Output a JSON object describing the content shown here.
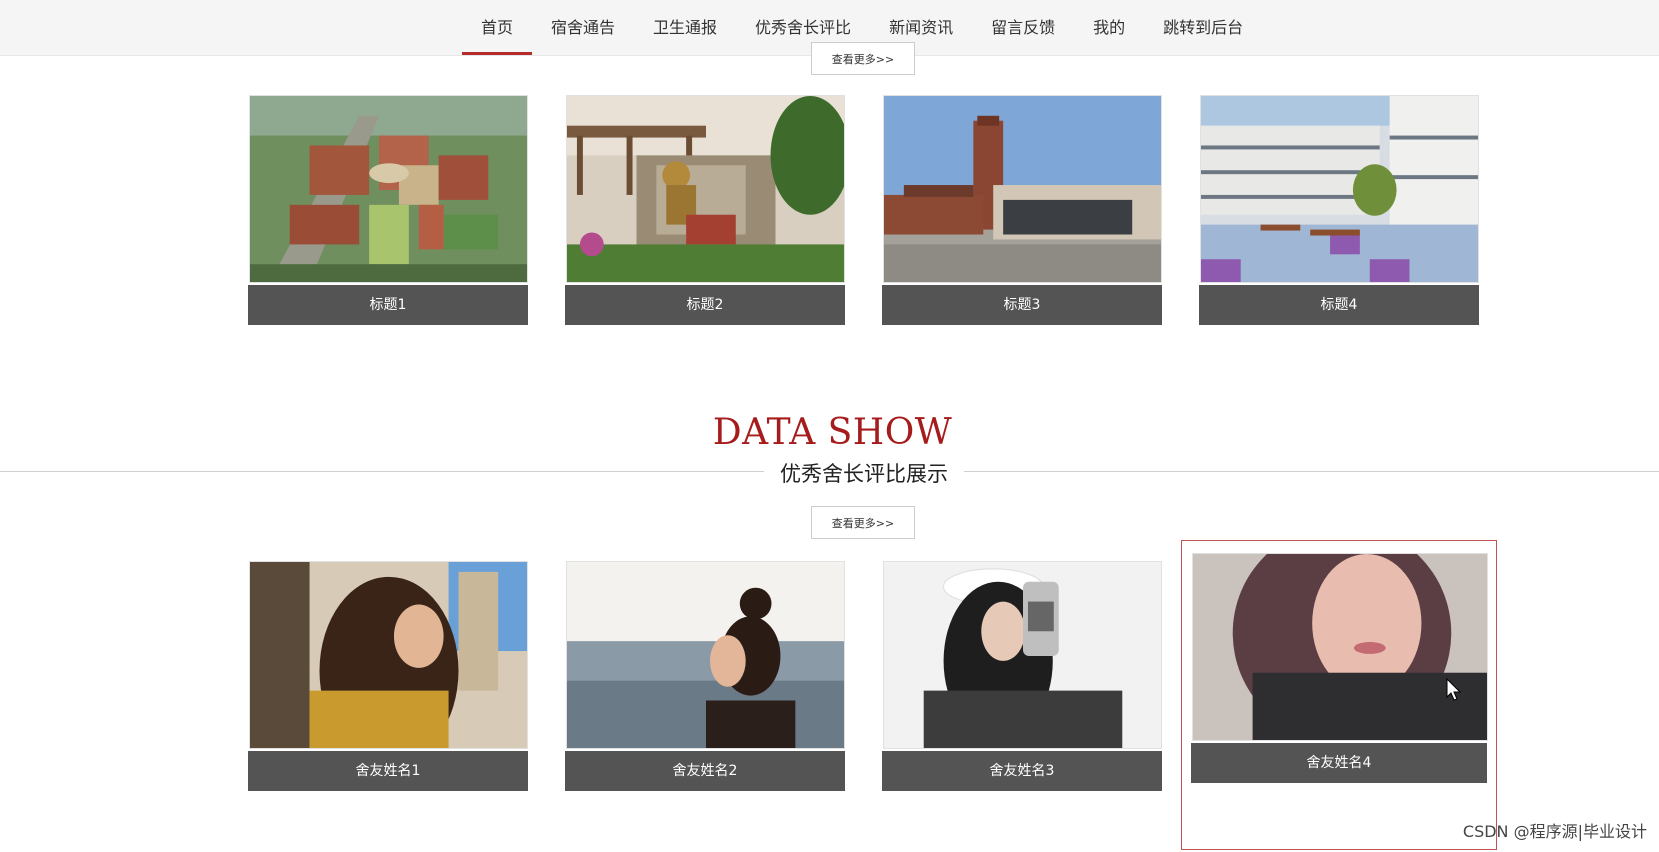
{
  "nav": {
    "items": [
      {
        "label": "首页",
        "active": true
      },
      {
        "label": "宿舍通告"
      },
      {
        "label": "卫生通报"
      },
      {
        "label": "优秀舍长评比"
      },
      {
        "label": "新闻资讯"
      },
      {
        "label": "留言反馈"
      },
      {
        "label": "我的"
      },
      {
        "label": "跳转到后台"
      }
    ],
    "active_color": "#b52a2a"
  },
  "top_section": {
    "more_label": "查看更多>>",
    "cards": [
      {
        "caption": "标题1",
        "image": "campus-aerial-image"
      },
      {
        "caption": "标题2",
        "image": "sculpture-garden-image"
      },
      {
        "caption": "标题3",
        "image": "school-building-image"
      },
      {
        "caption": "标题4",
        "image": "courtyard-building-image"
      }
    ]
  },
  "data_section": {
    "title": "DATA SHOW",
    "subtitle": "优秀舍长评比展示",
    "title_color": "#a61b1b",
    "more_label": "查看更多>>",
    "cards": [
      {
        "caption": "舍友姓名1",
        "image": "portrait-photo"
      },
      {
        "caption": "舍友姓名2",
        "image": "portrait-photo"
      },
      {
        "caption": "舍友姓名3",
        "image": "portrait-photo"
      },
      {
        "caption": "舍友姓名4",
        "image": "portrait-photo",
        "highlighted": true
      }
    ]
  },
  "watermark": "CSDN @程序源|毕业设计",
  "colors": {
    "caption_bg": "#545454",
    "caption_text": "#ffffff"
  }
}
